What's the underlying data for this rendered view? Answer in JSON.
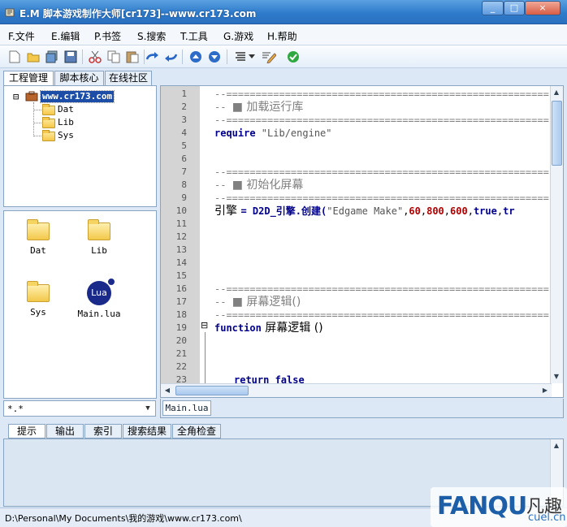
{
  "window": {
    "title": "E.M 脚本游戏制作大师[cr173]--www.cr173.com",
    "min": "_",
    "max": "□",
    "close": "×"
  },
  "menu": [
    "F.文件",
    "E.编辑",
    "P.书签",
    "S.搜索",
    "T.工具",
    "G.游戏",
    "H.帮助"
  ],
  "toolbar_icons": [
    "new-file-icon",
    "open-folder-icon",
    "save-all-icon",
    "save-icon",
    "cut-icon",
    "copy-icon",
    "paste-icon",
    "redo-icon",
    "undo-icon",
    "move-up-icon",
    "move-down-icon",
    "format-icon",
    "dropdown-icon",
    "edit-icon",
    "check-icon"
  ],
  "left_tabs": [
    "工程管理",
    "脚本核心",
    "在线社区"
  ],
  "tree": {
    "root": "www.cr173.com",
    "children": [
      "Dat",
      "Lib",
      "Sys"
    ],
    "expand_glyph": "⊟"
  },
  "files": [
    {
      "name": "Dat",
      "type": "folder"
    },
    {
      "name": "Lib",
      "type": "folder"
    },
    {
      "name": "Sys",
      "type": "folder"
    },
    {
      "name": "Main.lua",
      "type": "lua",
      "badge": "Lua"
    }
  ],
  "filter": {
    "value": "*.*",
    "arrow": "▼"
  },
  "editor": {
    "line_numbers": [
      "1",
      "2",
      "3",
      "4",
      "5",
      "6",
      "7",
      "8",
      "9",
      "10",
      "11",
      "12",
      "13",
      "14",
      "15",
      "16",
      "17",
      "18",
      "19",
      "20",
      "21",
      "22",
      "23"
    ],
    "lines": {
      "l1": "--=======================================================",
      "l2a": "-- ",
      "l2b": "■ 加载运行库",
      "l3": "--=======================================================",
      "l4a": "require",
      "l4b": " \"Lib/engine\"",
      "l7": "--=======================================================",
      "l8a": "-- ",
      "l8b": "■ 初始化屏幕",
      "l9": "--=======================================================",
      "l10a": "引擎 ",
      "l10b": "= D2D_引擎.创建(",
      "l10c": "\"Edgame Make\"",
      "l10d": ",",
      "l10e": "60",
      "l10f": ",",
      "l10g": "800",
      "l10h": ",",
      "l10i": "600",
      "l10j": ",",
      "l10k": "true",
      "l10l": ",",
      "l10m": "tr",
      "l16": "--=======================================================",
      "l17a": "-- ",
      "l17b": "■ 屏幕逻辑()",
      "l18": "--=======================================================",
      "l19a": "function",
      "l19b": " 屏幕逻辑 ()",
      "l23a": "return",
      "l23b": " false"
    },
    "fold_glyph": "⊟"
  },
  "editor_tab": "Main.lua",
  "bottom_tabs": [
    "提示",
    "输出",
    "索引",
    "搜索结果",
    "全角检查"
  ],
  "status": {
    "path": "D:\\Personal\\My Documents\\我的游戏\\www.cr173.com\\"
  },
  "watermark": {
    "brand": "FANQU",
    "zh": "凡趣",
    "site": "cuel.cn"
  }
}
